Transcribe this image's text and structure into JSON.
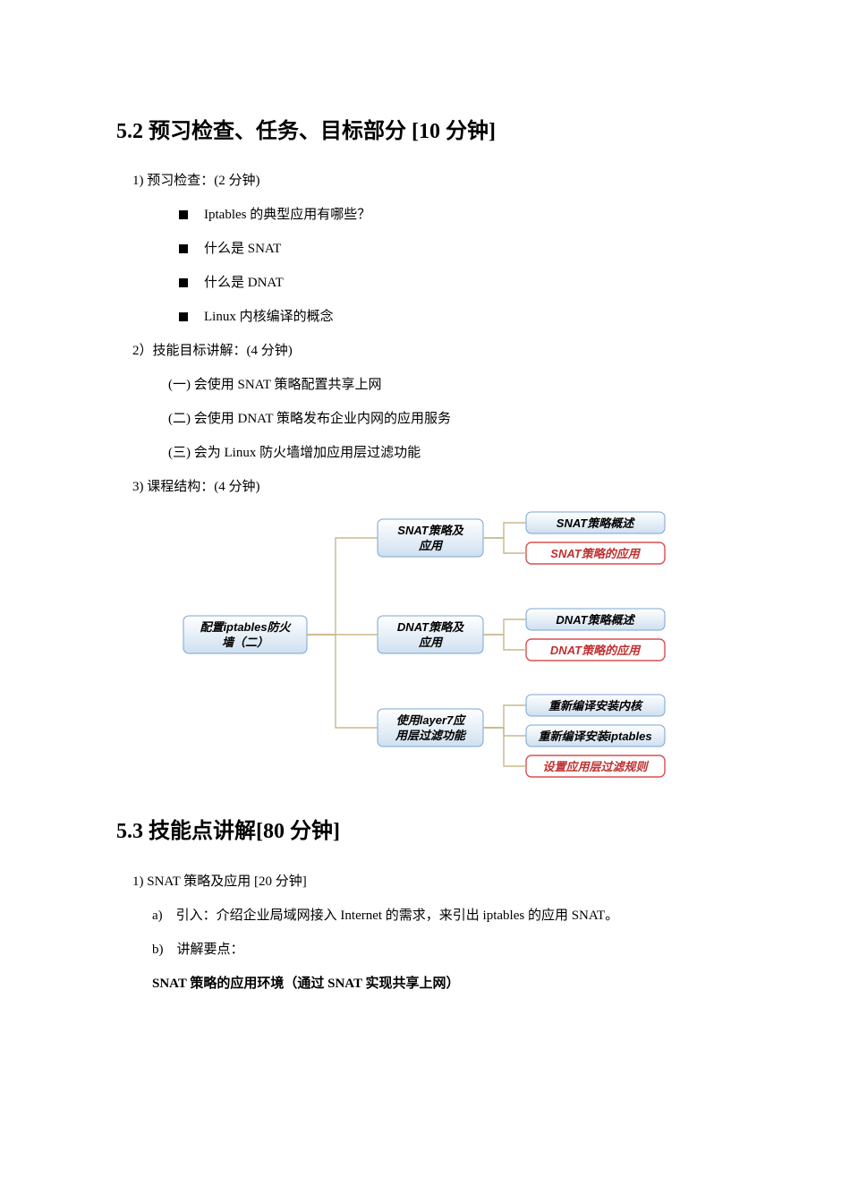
{
  "s52": {
    "heading": "5.2 预习检查、任务、目标部分 [10 分钟]",
    "check": {
      "title": "1) 预习检查：(2 分钟)",
      "q1": "Iptables 的典型应用有哪些？",
      "q2": "什么是 SNAT",
      "q3": "什么是 DNAT",
      "q4": "Linux 内核编译的概念"
    },
    "skill": {
      "title": "2）技能目标讲解：(4 分钟)",
      "i1": "(一) 会使用 SNAT 策略配置共享上网",
      "i2": "(二) 会使用 DNAT 策略发布企业内网的应用服务",
      "i3": "(三) 会为 Linux 防火墙增加应用层过滤功能"
    },
    "structure": {
      "title": "3) 课程结构：(4 分钟)"
    }
  },
  "flowchart": {
    "root_l1": "配置iptables防火",
    "root_l2": "墙（二）",
    "b1_l1": "SNAT策略及",
    "b1_l2": "应用",
    "b1c1": "SNAT策略概述",
    "b1c2": "SNAT策略的应用",
    "b2_l1": "DNAT策略及",
    "b2_l2": "应用",
    "b2c1": "DNAT策略概述",
    "b2c2": "DNAT策略的应用",
    "b3_l1": "使用layer7应",
    "b3_l2": "用层过滤功能",
    "b3c1": "重新编译安装内核",
    "b3c2": "重新编译安装iptables",
    "b3c3": "设置应用层过滤规则"
  },
  "s53": {
    "heading": "5.3 技能点讲解[80 分钟]",
    "p1": "1) SNAT 策略及应用 [20 分钟]",
    "a": "a)　引入：介绍企业局域网接入 Internet 的需求，来引出 iptables 的应用 SNAT。",
    "b": "b)　讲解要点：",
    "bold": "SNAT 策略的应用环境（通过 SNAT 实现共享上网）"
  }
}
